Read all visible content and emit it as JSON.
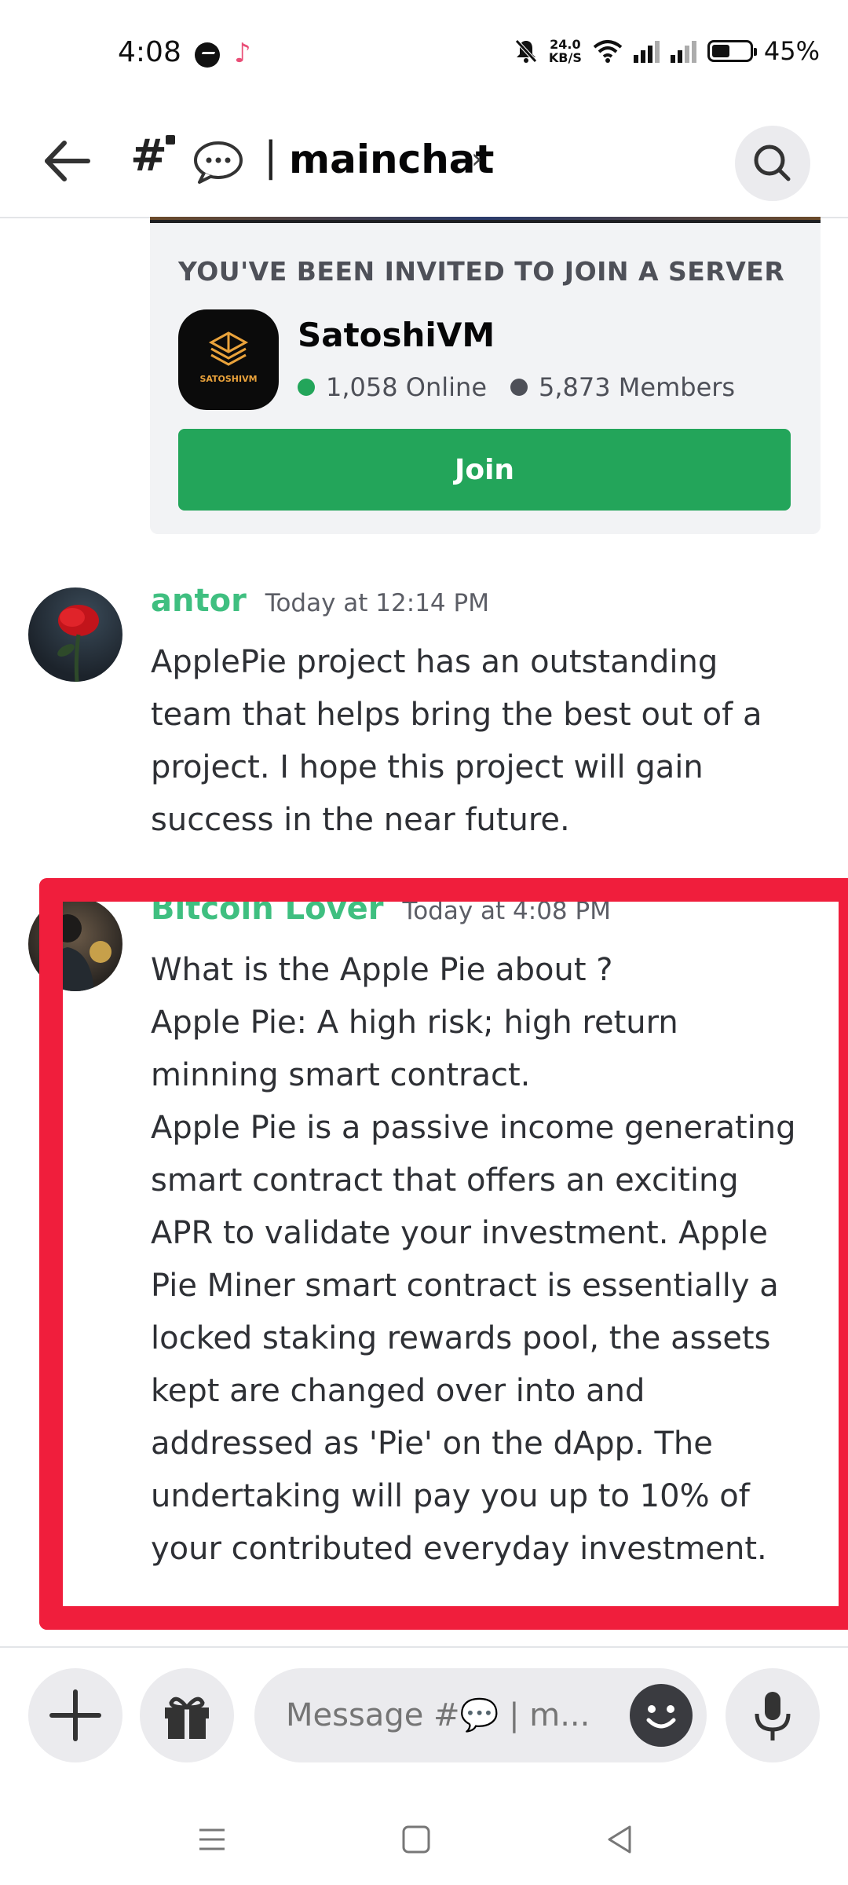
{
  "status_bar": {
    "time": "4:08",
    "net_speed_value": "24.0",
    "net_speed_unit": "KB/S",
    "battery": "45%",
    "icons": [
      "messenger-icon",
      "tiktok-icon",
      "mute-icon",
      "wifi-icon",
      "signal-icon",
      "signal-icon",
      "battery-icon"
    ]
  },
  "header": {
    "channel_name": "mainchat",
    "back_icon": "arrow-left-icon",
    "search_icon": "search-icon"
  },
  "invite": {
    "heading": "YOU'VE BEEN INVITED TO JOIN A SERVER",
    "server_name": "SatoshiVM",
    "server_icon_text": "SATOSHIVM",
    "online": "1,058 Online",
    "members": "5,873 Members",
    "join_label": "Join"
  },
  "messages": [
    {
      "author": "antor",
      "time": "Today at 12:14 PM",
      "lines": [
        "ApplePie project has an outstanding",
        "team that helps bring the best out of a",
        "project. I hope this project will gain",
        "success in the near future."
      ]
    },
    {
      "author": "Bitcoin Lover",
      "time": "Today at 4:08 PM",
      "lines": [
        "What is the Apple Pie about ?",
        "Apple Pie: A high risk; high return",
        "minning smart contract.",
        "Apple Pie is a passive income generating",
        "smart contract that offers an exciting",
        "APR to validate your investment. Apple",
        "Pie Miner smart contract is essentially a",
        "locked staking rewards pool, the assets",
        "kept are changed over into and",
        "addressed as 'Pie' on the dApp. The",
        "undertaking will pay you up to 10% of",
        "your contributed everyday investment."
      ]
    }
  ],
  "composer": {
    "placeholder": "Message #💬 | m..."
  },
  "colors": {
    "online_green": "#23a55a",
    "author_green": "#3fbf80",
    "highlight_red": "#f01e3c"
  }
}
